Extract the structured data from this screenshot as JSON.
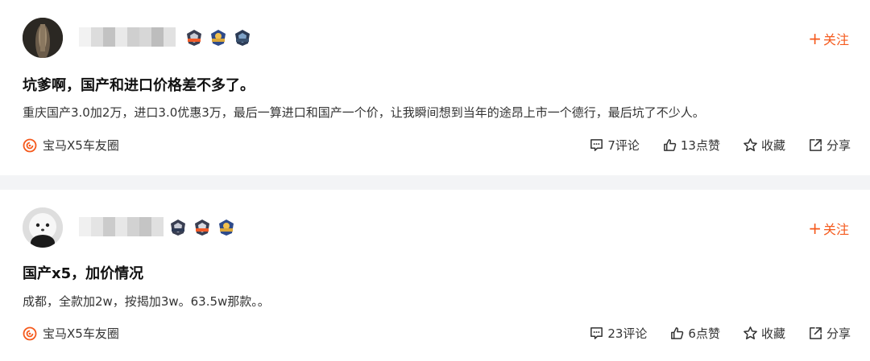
{
  "posts": [
    {
      "title": "坑爹啊，国产和进口价格差不多了。",
      "content": "重庆国产3.0加2万，进口3.0优惠3万，最后一算进口和国产一个价，让我瞬间想到当年的途昂上市一个德行，最后坑了不少人。",
      "follow_label": "关注",
      "circle": "宝马X5车友圈",
      "comments": "7评论",
      "likes": "13点赞",
      "favorite": "收藏",
      "share": "分享"
    },
    {
      "title": "国产x5，加价情况",
      "content": "成都，全款加2w，按揭加3w。63.5w那款。。",
      "follow_label": "关注",
      "circle": "宝马X5车友圈",
      "comments": "23评论",
      "likes": "6点赞",
      "favorite": "收藏",
      "share": "分享"
    }
  ],
  "colors": {
    "accent": "#f55a1d",
    "separator": "#f3f4f6"
  },
  "icons": [
    "plus-icon",
    "circle-logo-icon",
    "comment-icon",
    "thumbs-up-icon",
    "star-icon",
    "share-icon"
  ]
}
